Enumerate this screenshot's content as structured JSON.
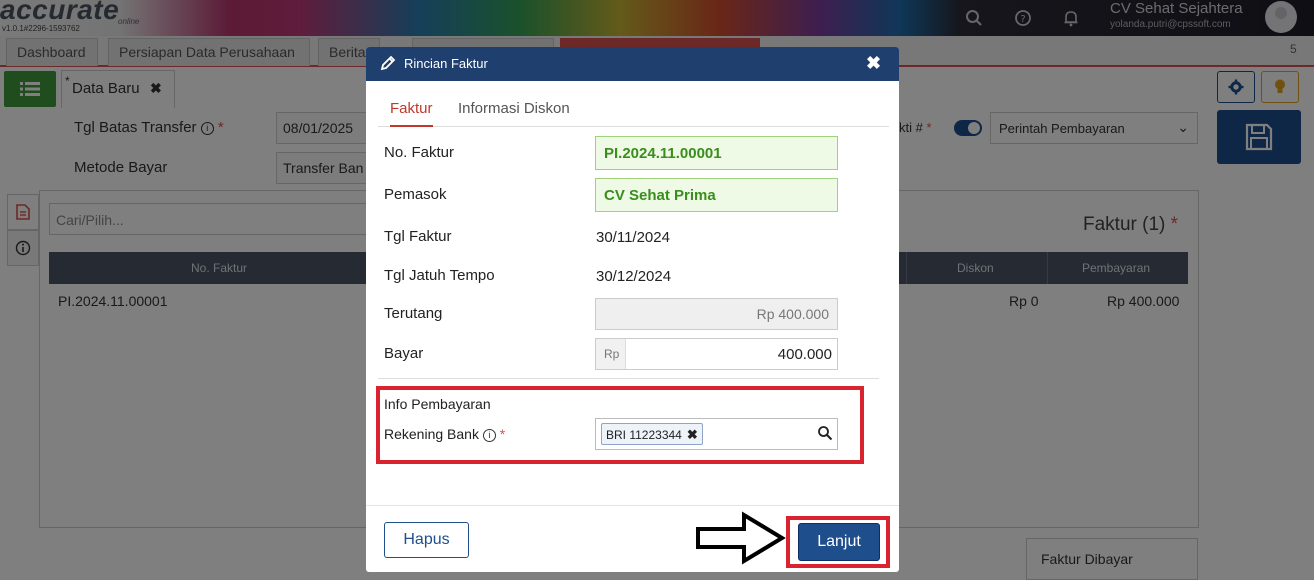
{
  "app": {
    "logo": "accurate",
    "logo_sub": "online",
    "version": "v1.0.1#2296-1593762",
    "company": "CV Sehat Sejahtera",
    "user_email": "yolanda.putri@cpssoft.com",
    "icons": [
      "search-icon",
      "help-icon",
      "bell-icon"
    ]
  },
  "app_tabs": [
    "Dashboard",
    "Persiapan Data Perusahaan",
    "Berita",
    "",
    ""
  ],
  "app_tab_count": "5",
  "doc_tab": {
    "star": "*",
    "label": "Data Baru",
    "close": "✖"
  },
  "form": {
    "tgl_label": "Tgl Batas Transfer",
    "tgl_value": "08/01/2025",
    "metode_label": "Metode Bayar",
    "metode_value": "Transfer Ban",
    "bukti_label": "kti #",
    "bukti_select": "Perintah Pembayaran"
  },
  "list": {
    "search_placeholder": "Cari/Pilih...",
    "count_label": "Faktur (1)",
    "columns": [
      "No. Faktur",
      "Diskon",
      "Pembayaran"
    ],
    "row": {
      "no_faktur": "PI.2024.11.00001",
      "diskon": "Rp 0",
      "pembayaran": "Rp 400.000"
    },
    "footer_tab": "Faktur Dibayar"
  },
  "modal": {
    "title": "Rincian Faktur",
    "close": "✖",
    "tabs": [
      "Faktur",
      "Informasi Diskon"
    ],
    "fields": {
      "no_faktur_label": "No. Faktur",
      "no_faktur_value": "PI.2024.11.00001",
      "pemasok_label": "Pemasok",
      "pemasok_value": "CV Sehat Prima",
      "tgl_faktur_label": "Tgl Faktur",
      "tgl_faktur_value": "30/11/2024",
      "tgl_jatuh_tempo_label": "Tgl Jatuh Tempo",
      "tgl_jatuh_tempo_value": "30/12/2024",
      "terutang_label": "Terutang",
      "terutang_value": "Rp 400.000",
      "bayar_label": "Bayar",
      "bayar_prefix": "Rp",
      "bayar_value": "400.000"
    },
    "info": {
      "title": "Info Pembayaran",
      "rekening_label": "Rekening Bank",
      "rekening_tag": "BRI 11223344"
    },
    "buttons": {
      "hapus": "Hapus",
      "lanjut": "Lanjut"
    }
  },
  "colors": {
    "primary": "#1f4e8c",
    "modal_header": "#1f3f6e",
    "highlight_frame": "#d9232e",
    "active_tab": "#c0392b",
    "green_field_bg": "#eef9e6",
    "green_field_text": "#3a8e1c"
  }
}
